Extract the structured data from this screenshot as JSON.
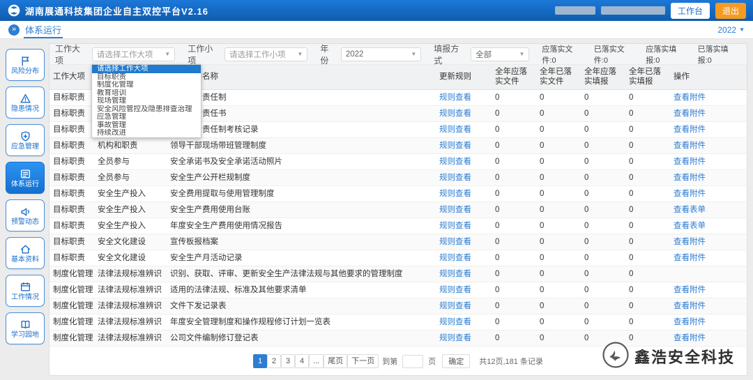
{
  "topbar": {
    "title": "湖南展通科技集团企业自主双控平台V2.16",
    "workbench_label": "工作台",
    "logout_label": "退出"
  },
  "breadcrumb": {
    "label": "体系运行",
    "year": "2022"
  },
  "sidebar": {
    "items": [
      {
        "key": "risk",
        "label": "风险分布",
        "icon": "risk-flag-icon",
        "active": false
      },
      {
        "key": "hazard",
        "label": "隐患情况",
        "icon": "hazard-warning-icon",
        "active": false
      },
      {
        "key": "emergency",
        "label": "应急管理",
        "icon": "emergency-shield-icon",
        "active": false
      },
      {
        "key": "system",
        "label": "体系运行",
        "icon": "system-run-icon",
        "active": true
      },
      {
        "key": "alert",
        "label": "预警动态",
        "icon": "alert-megaphone-icon",
        "active": false
      },
      {
        "key": "basic",
        "label": "基本资料",
        "icon": "basic-info-home-icon",
        "active": false
      },
      {
        "key": "work",
        "label": "工作情况",
        "icon": "work-calendar-icon",
        "active": false
      },
      {
        "key": "learn",
        "label": "学习园地",
        "icon": "learning-book-icon",
        "active": false
      }
    ]
  },
  "filters": {
    "major_label": "工作大项",
    "major_value": "请选择工作大项",
    "minor_label": "工作小项",
    "minor_value": "请选择工作小项",
    "year_label": "年份",
    "year_value": "2022",
    "mode_label": "填报方式",
    "mode_value": "全部",
    "stats": [
      {
        "label": "应落实文件",
        "value": "0"
      },
      {
        "label": "已落实文件",
        "value": "0"
      },
      {
        "label": "应落实填报",
        "value": "0"
      },
      {
        "label": "已落实填报",
        "value": "0"
      }
    ]
  },
  "dropdown": {
    "selected_index": 0,
    "options": [
      "请选择工作大项",
      "目标职责",
      "制度化管理",
      "教育培训",
      "现场管理",
      "安全风险管控及隐患排查治理",
      "应急管理",
      "事故管理",
      "持续改进"
    ]
  },
  "table": {
    "headers": [
      "工作大项",
      "工作小项",
      "体系文件名称",
      "更新规则",
      "全年应落实文件",
      "全年已落实文件",
      "全年应落实填报",
      "全年已落实填报",
      "操作"
    ],
    "rule_link": "规则查看",
    "rows": [
      {
        "major": "目标职责",
        "minor": "",
        "name": "安全生产责任制",
        "f1": "0",
        "f2": "0",
        "f3": "0",
        "f4": "0",
        "action": "查看附件"
      },
      {
        "major": "目标职责",
        "minor": "",
        "name": "安全生产责任书",
        "f1": "0",
        "f2": "0",
        "f3": "0",
        "f4": "0",
        "action": "查看附件"
      },
      {
        "major": "目标职责",
        "minor": "",
        "name": "安全生产责任制考核记录",
        "f1": "0",
        "f2": "0",
        "f3": "0",
        "f4": "0",
        "action": "查看附件"
      },
      {
        "major": "目标职责",
        "minor": "机构和职责",
        "name": "领导干部现场带班管理制度",
        "f1": "0",
        "f2": "0",
        "f3": "0",
        "f4": "0",
        "action": "查看附件"
      },
      {
        "major": "目标职责",
        "minor": "全员参与",
        "name": "安全承诺书及安全承诺活动照片",
        "f1": "0",
        "f2": "0",
        "f3": "0",
        "f4": "0",
        "action": "查看附件"
      },
      {
        "major": "目标职责",
        "minor": "全员参与",
        "name": "安全生产公开栏规制度",
        "f1": "0",
        "f2": "0",
        "f3": "0",
        "f4": "0",
        "action": "查看附件"
      },
      {
        "major": "目标职责",
        "minor": "安全生产投入",
        "name": "安全费用提取与使用管理制度",
        "f1": "0",
        "f2": "0",
        "f3": "0",
        "f4": "0",
        "action": "查看附件"
      },
      {
        "major": "目标职责",
        "minor": "安全生产投入",
        "name": "安全生产费用使用台账",
        "f1": "0",
        "f2": "0",
        "f3": "0",
        "f4": "0",
        "action": "查看表单"
      },
      {
        "major": "目标职责",
        "minor": "安全生产投入",
        "name": "年度安全生产费用使用情况报告",
        "f1": "0",
        "f2": "0",
        "f3": "0",
        "f4": "0",
        "action": "查看表单"
      },
      {
        "major": "目标职责",
        "minor": "安全文化建设",
        "name": "宣传板报档案",
        "f1": "0",
        "f2": "0",
        "f3": "0",
        "f4": "0",
        "action": "查看附件"
      },
      {
        "major": "目标职责",
        "minor": "安全文化建设",
        "name": "安全生产月活动记录",
        "f1": "0",
        "f2": "0",
        "f3": "0",
        "f4": "0",
        "action": "查看附件"
      },
      {
        "major": "制度化管理",
        "minor": "法律法规标准辨识",
        "name": "识别、获取、评审、更新安全生产法律法规与其他要求的管理制度",
        "f1": "0",
        "f2": "0",
        "f3": "0",
        "f4": "0",
        "action": ""
      },
      {
        "major": "制度化管理",
        "minor": "法律法规标准辨识",
        "name": "适用的法律法规、标准及其他要求清单",
        "f1": "0",
        "f2": "0",
        "f3": "0",
        "f4": "0",
        "action": "查看附件"
      },
      {
        "major": "制度化管理",
        "minor": "法律法规标准辨识",
        "name": "文件下发记录表",
        "f1": "0",
        "f2": "0",
        "f3": "0",
        "f4": "0",
        "action": "查看附件"
      },
      {
        "major": "制度化管理",
        "minor": "法律法规标准辨识",
        "name": "年度安全管理制度和操作规程修订计划一览表",
        "f1": "0",
        "f2": "0",
        "f3": "0",
        "f4": "0",
        "action": "查看附件"
      },
      {
        "major": "制度化管理",
        "minor": "法律法规标准辨识",
        "name": "公司文件编制修订登记表",
        "f1": "0",
        "f2": "0",
        "f3": "0",
        "f4": "0",
        "action": "查看附件"
      }
    ]
  },
  "pagination": {
    "pages": [
      "1",
      "2",
      "3",
      "4",
      "..."
    ],
    "active_page": "1",
    "last_label": "尾页",
    "next_label": "下一页",
    "goto_prefix": "到第",
    "goto_suffix": "页",
    "goto_value": "",
    "confirm_label": "确定",
    "summary": "共12页,181 条记录"
  },
  "watermark": {
    "text": "鑫浩安全科技"
  }
}
